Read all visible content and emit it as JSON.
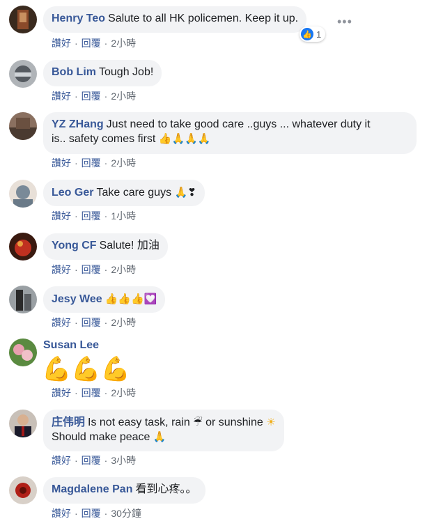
{
  "actions": {
    "like": "讚好",
    "reply": "回覆",
    "sep": "·"
  },
  "comments": [
    {
      "name": "Henry Teo",
      "text": "Salute to all HK policemen. Keep it up.",
      "time": "2小時",
      "reaction_count": "1",
      "avatar_colors": [
        "#3a2a1e",
        "#8b4a2a"
      ]
    },
    {
      "name": "Bob Lim",
      "text": "Tough Job!",
      "time": "2小時",
      "avatar_colors": [
        "#555a60",
        "#b0b4b8"
      ]
    },
    {
      "name": "YZ ZHang",
      "text_line1": "Just need to take good care ..guys ... whatever duty it",
      "text_line2": "is.. safety comes first",
      "emoji": "👍🙏🙏🙏",
      "time": "2小時",
      "avatar_colors": [
        "#4a3a30",
        "#8a7060"
      ]
    },
    {
      "name": "Leo Ger",
      "text": "Take care guys",
      "emoji": "🙏❣",
      "time": "1小時",
      "avatar_colors": [
        "#7a8a98",
        "#e8e0d8"
      ]
    },
    {
      "name": "Yong CF",
      "text": "Salute! 加油",
      "time": "2小時",
      "avatar_colors": [
        "#3a1a10",
        "#c03020"
      ]
    },
    {
      "name": "Jesy Wee",
      "emoji": "👍👍👍💟",
      "time": "2小時",
      "avatar_colors": [
        "#2a2a2a",
        "#9aa0a4"
      ]
    },
    {
      "name": "Susan Lee",
      "emoji": "💪💪💪",
      "time": "2小時",
      "avatar_colors": [
        "#5a8a40",
        "#e8a0b0"
      ]
    },
    {
      "name": "庄伟明",
      "text_line1": "Is not easy task, rain",
      "text_line1b": "or sunshine",
      "text_line2": "Should make peace",
      "emoji_rain": "☔",
      "emoji_sun": "☀",
      "emoji_pray": "🙏",
      "time": "3小時",
      "avatar_colors": [
        "#c8c0b8",
        "#a01818"
      ]
    },
    {
      "name": "Magdalene Pan",
      "text": "看到心疼。。",
      "time": "30分鐘",
      "avatar_colors": [
        "#d8d0c8",
        "#b02018"
      ]
    }
  ],
  "colors": {
    "name": "#385898",
    "bubble": "#f2f3f5",
    "meta": "#606770",
    "like": "#1877f2"
  },
  "icons": {
    "reaction": "like-icon",
    "more": "more-icon"
  }
}
